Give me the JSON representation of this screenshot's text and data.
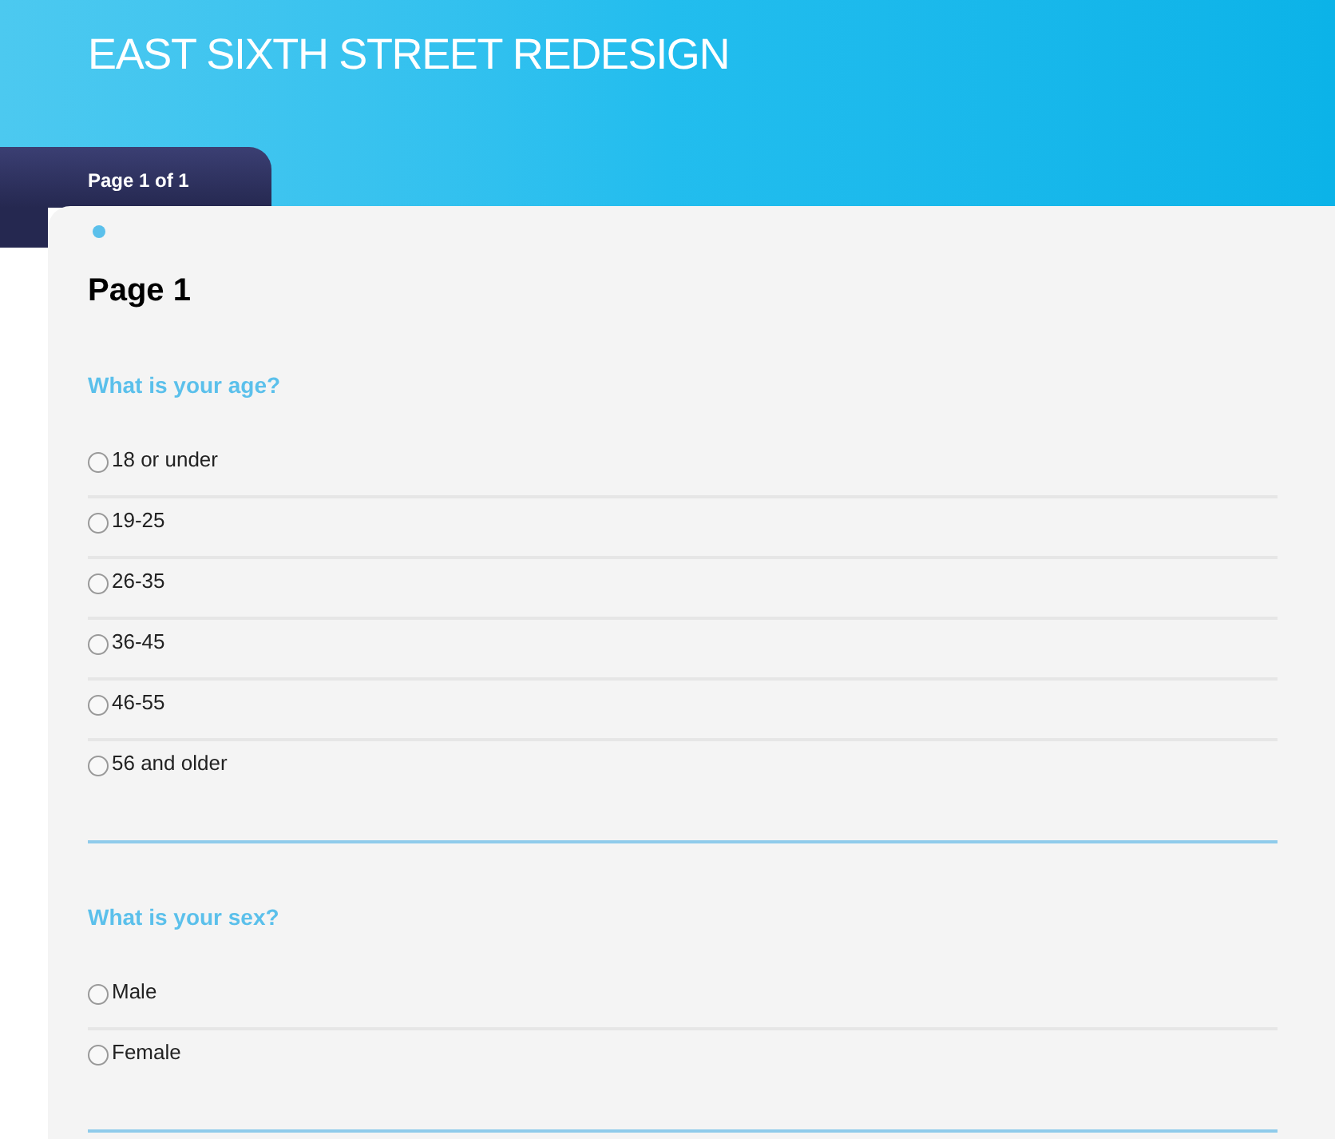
{
  "header": {
    "title": "EAST SIXTH STREET REDESIGN"
  },
  "page_tab": {
    "label": "Page 1 of 1"
  },
  "page": {
    "title": "Page 1"
  },
  "questions": [
    {
      "title": "What is your age?",
      "options": [
        {
          "label": "18 or under",
          "selected": false
        },
        {
          "label": "19-25",
          "selected": false
        },
        {
          "label": "26-35",
          "selected": false
        },
        {
          "label": "36-45",
          "selected": false
        },
        {
          "label": "46-55",
          "selected": false
        },
        {
          "label": "56 and older",
          "selected": false
        }
      ]
    },
    {
      "title": "What is your sex?",
      "options": [
        {
          "label": "Male",
          "selected": false
        },
        {
          "label": "Female",
          "selected": false
        }
      ]
    }
  ]
}
